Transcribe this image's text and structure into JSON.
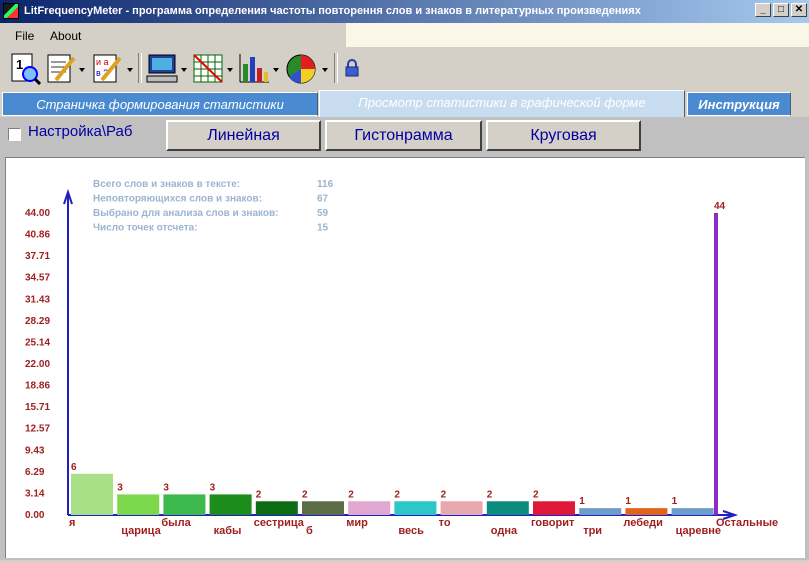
{
  "window": {
    "title": "LitFrequencyMeter - программа определения частоты повторення слов и знаков в литературных произведениях"
  },
  "window_controls": {
    "minimize": "_",
    "maximize": "□",
    "close": "✕"
  },
  "menu": {
    "file": "File",
    "about": "About"
  },
  "toolbar": {
    "icons": [
      "new-document-icon",
      "edit-document-icon",
      "notes-icon",
      "monitor-icon",
      "grid-icon",
      "bar-chart-icon",
      "pie-chart-icon",
      "lock-icon"
    ]
  },
  "tabs": [
    {
      "label": "Страничка формирования статистики"
    },
    {
      "label": "Просмотр статистики в графической форме"
    },
    {
      "label": "Инструкция"
    }
  ],
  "controls": {
    "settings_label": "Настройка\\Раб",
    "linear_button": "Линейная",
    "histogram_button": "Гистонрамма",
    "pie_button": "Круговая"
  },
  "stats": {
    "rows": [
      {
        "label": "Всего слов и знаков в тексте:",
        "value": "116"
      },
      {
        "label": "Неповторяющихся слов и знаков:",
        "value": "67"
      },
      {
        "label": "Выбрано для анализа слов и знаков:",
        "value": "59"
      },
      {
        "label": "Число точек отсчета:",
        "value": "15"
      }
    ]
  },
  "colors": {
    "axis": "#2020c0",
    "tick_label": "#a02020",
    "stats_text": "#9cb4d0"
  },
  "chart_data": {
    "type": "bar",
    "y_ticks": [
      "44.00",
      "40.86",
      "37.71",
      "34.57",
      "31.43",
      "28.29",
      "25.14",
      "22.00",
      "18.86",
      "15.71",
      "12.57",
      "9.43",
      "6.29",
      "3.14",
      "0.00"
    ],
    "ylim": [
      0,
      44
    ],
    "categories": [
      "я",
      "царица",
      "была",
      "кабы",
      "сестрица",
      "б",
      "мир",
      "весь",
      "то",
      "одна",
      "говорит",
      "три",
      "лебеди",
      "царевне",
      "Остальные"
    ],
    "values": [
      6,
      3,
      3,
      3,
      2,
      2,
      2,
      2,
      2,
      2,
      2,
      1,
      1,
      1,
      44
    ],
    "colors": [
      "#a8e088",
      "#7cd84c",
      "#3cb84c",
      "#1c8c1c",
      "#0c6c14",
      "#5c6c44",
      "#e0a8d0",
      "#2cc8c8",
      "#e8a8b0",
      "#0c8c7c",
      "#e01838",
      "#6c9cc8",
      "#e0641c",
      "#6c9cc8",
      "#8c2cc8"
    ]
  }
}
